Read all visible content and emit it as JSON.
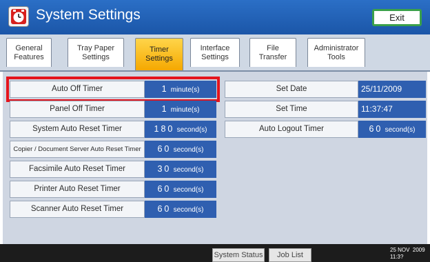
{
  "window": {
    "title": "System Settings",
    "exit_label": "Exit"
  },
  "tabs": [
    {
      "label": "General\nFeatures",
      "active": false
    },
    {
      "label": "Tray Paper\nSettings",
      "active": false
    },
    {
      "label": "Timer\nSettings",
      "active": true
    },
    {
      "label": "Interface\nSettings",
      "active": false
    },
    {
      "label": "File\nTransfer",
      "active": false
    },
    {
      "label": "Administrator\nTools",
      "active": false
    }
  ],
  "left_settings": [
    {
      "label": "Auto Off Timer",
      "value": "1",
      "unit": "minute(s)",
      "selected": true
    },
    {
      "label": "Panel Off Timer",
      "value": "1",
      "unit": "minute(s)"
    },
    {
      "label": "System Auto Reset Timer",
      "value": "180",
      "unit": "second(s)"
    },
    {
      "label": "Copier / Document Server Auto Reset Timer",
      "value": "60",
      "unit": "second(s)"
    },
    {
      "label": "Facsimile Auto Reset Timer",
      "value": "30",
      "unit": "second(s)"
    },
    {
      "label": "Printer Auto Reset Timer",
      "value": "60",
      "unit": "second(s)"
    },
    {
      "label": "Scanner Auto Reset Timer",
      "value": "60",
      "unit": "second(s)"
    }
  ],
  "right_settings": [
    {
      "label": "Set Date",
      "value": "25/11/2009"
    },
    {
      "label": "Set Time",
      "value": "11:37:47"
    },
    {
      "label": "Auto Logout Timer",
      "value": "60",
      "unit": "second(s)"
    }
  ],
  "status_bar": {
    "system_status_label": "System Status",
    "job_list_label": "Job List",
    "date": "25 NOV  2009",
    "time": "11:3?"
  },
  "colors": {
    "title_bar": "#1b56a8",
    "active_tab": "#f5a800",
    "value_field": "#2f5fb0",
    "selection_outline": "#e4141d",
    "exit_border": "#3aa04a"
  },
  "icons": {
    "app_icon": "clock-icon"
  }
}
